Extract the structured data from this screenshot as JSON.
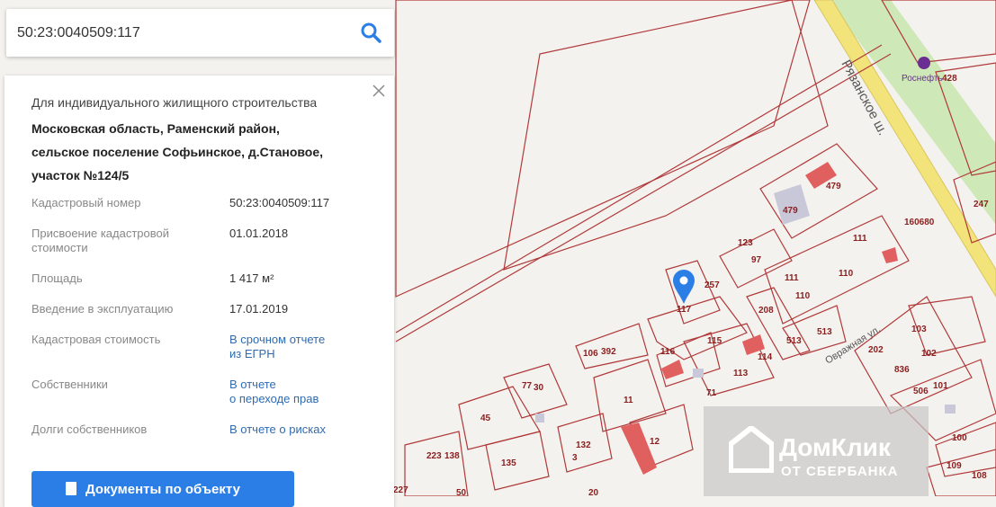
{
  "search": {
    "value": "50:23:0040509:117"
  },
  "panel": {
    "purpose": "Для индивидуального жилищного строительства",
    "address_lines": [
      "Московская область, Раменский район,",
      "сельское поселение Софьинское, д.Становое,",
      "участок №124/5"
    ],
    "rows": [
      {
        "key": [
          "Кадастровый номер"
        ],
        "value": [
          "50:23:0040509:117"
        ],
        "link": false
      },
      {
        "key": [
          "Присвоение кадастровой",
          "стоимости"
        ],
        "value": [
          "01.01.2018"
        ],
        "link": false
      },
      {
        "key": [
          "Площадь"
        ],
        "value": [
          "1 417 м²"
        ],
        "link": false
      },
      {
        "key": [
          "Введение в эксплуатацию"
        ],
        "value": [
          "17.01.2019"
        ],
        "link": false
      },
      {
        "key": [
          "Кадастровая стоимость"
        ],
        "value": [
          "В срочном отчете",
          "из ЕГРН"
        ],
        "link": true
      },
      {
        "key": [
          "Собственники"
        ],
        "value": [
          "В отчете",
          "о переходе прав"
        ],
        "link": true
      },
      {
        "key": [
          "Долги собственников"
        ],
        "value": [
          "В отчете о рисках"
        ],
        "link": true
      }
    ],
    "docs_button": "Документы по объекту"
  },
  "map": {
    "road_label": "Рязанское ш.",
    "street_label": "Овражная ул.",
    "poi_label": "Роснефть",
    "parcel_labels": [
      "428",
      "479",
      "479",
      "160680",
      "247",
      "123",
      "97",
      "111",
      "110",
      "111",
      "110",
      "257",
      "117",
      "208",
      "513",
      "513",
      "392",
      "106",
      "116",
      "115",
      "114",
      "113",
      "71",
      "11",
      "77",
      "30",
      "45",
      "12",
      "132",
      "3",
      "135",
      "138",
      "223",
      "50",
      "20",
      "202",
      "836",
      "103",
      "102",
      "101",
      "506",
      "100",
      "109",
      "108",
      "227"
    ]
  },
  "watermark": {
    "title": "ДомКлик",
    "subtitle": "ОТ СБЕРБАНКА"
  },
  "colors": {
    "accent": "#2a7ee6",
    "parcel_line": "#b0393a",
    "road": "#f2e37a",
    "green": "#cfe8b8"
  }
}
